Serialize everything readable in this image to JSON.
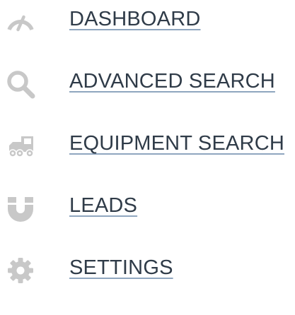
{
  "nav": {
    "items": [
      {
        "label": "DASHBOARD",
        "icon": "speedometer-icon"
      },
      {
        "label": "ADVANCED SEARCH",
        "icon": "search-icon"
      },
      {
        "label": "EQUIPMENT SEARCH",
        "icon": "truck-icon"
      },
      {
        "label": "LEADS",
        "icon": "magnet-icon"
      },
      {
        "label": "SETTINGS",
        "icon": "gear-icon"
      }
    ]
  },
  "colors": {
    "icon": "#c8c8c8",
    "text": "#2f3b48",
    "underline": "#8fa6bf"
  }
}
